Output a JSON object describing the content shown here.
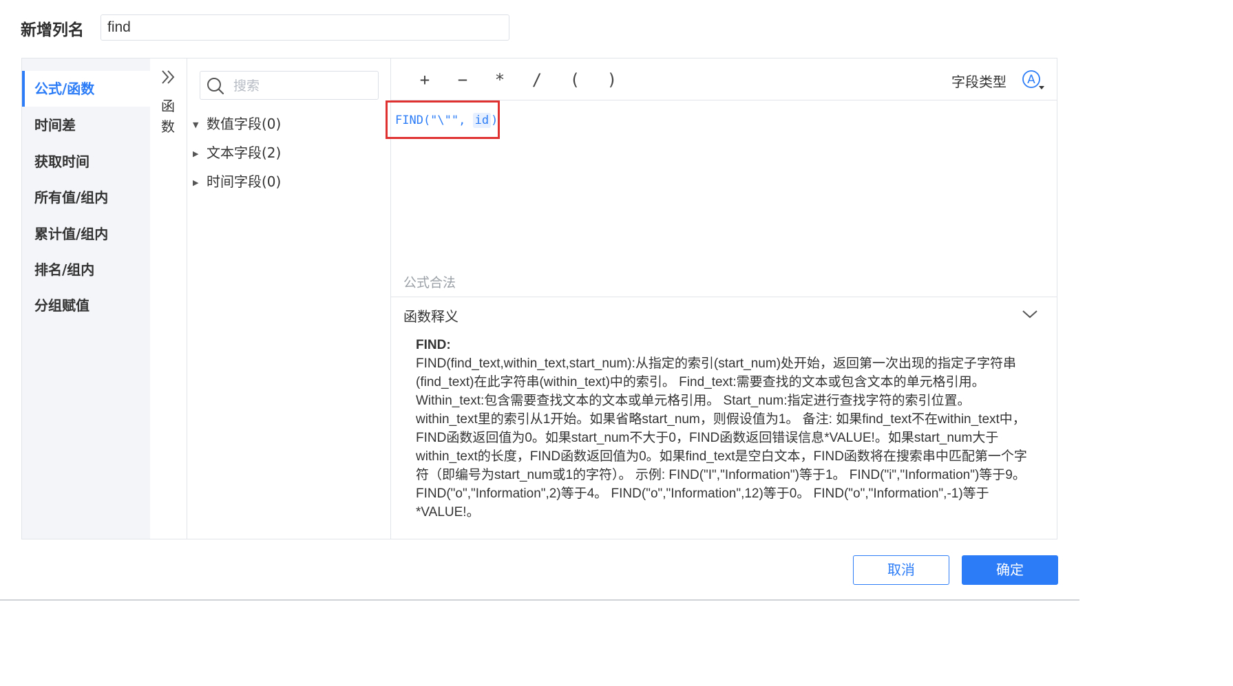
{
  "column_name": {
    "label": "新增列名",
    "value": "find"
  },
  "categories": [
    {
      "label": "公式/函数",
      "active": true
    },
    {
      "label": "时间差"
    },
    {
      "label": "获取时间"
    },
    {
      "label": "所有值/组内"
    },
    {
      "label": "累计值/组内"
    },
    {
      "label": "排名/组内"
    },
    {
      "label": "分组赋值"
    }
  ],
  "function_tab": {
    "label": "函数",
    "expand_icon": "double-chevron-right-icon"
  },
  "search": {
    "placeholder": "搜索",
    "value": ""
  },
  "field_groups": [
    {
      "label": "数值字段(0)",
      "expanded": true
    },
    {
      "label": "文本字段(2)",
      "expanded": false
    },
    {
      "label": "时间字段(0)",
      "expanded": false
    }
  ],
  "operators": [
    "+",
    "−",
    "*",
    "/",
    "(",
    ")"
  ],
  "field_type": {
    "label": "字段类型",
    "icon": "circled-a-dropdown-icon"
  },
  "formula": {
    "prefix": "FIND(\"\\\"\",",
    "field": "id",
    "suffix": ")"
  },
  "validity": "公式合法",
  "explanation": {
    "title": "函数释义",
    "heading": "FIND:",
    "body": "FIND(find_text,within_text,start_num):从指定的索引(start_num)处开始，返回第一次出现的指定子字符串(find_text)在此字符串(within_text)中的索引。 Find_text:需要查找的文本或包含文本的单元格引用。 Within_text:包含需要查找文本的文本或单元格引用。 Start_num:指定进行查找字符的索引位置。within_text里的索引从1开始。如果省略start_num，则假设值为1。 备注: 如果find_text不在within_text中，FIND函数返回值为0。如果start_num不大于0，FIND函数返回错误信息*VALUE!。如果start_num大于within_text的长度，FIND函数返回值为0。如果find_text是空白文本，FIND函数将在搜索串中匹配第一个字符（即编号为start_num或1的字符）。 示例: FIND(\"I\",\"Information\")等于1。 FIND(\"i\",\"Information\")等于9。 FIND(\"o\",\"Information\",2)等于4。 FIND(\"o\",\"Information\",12)等于0。 FIND(\"o\",\"Information\",-1)等于*VALUE!。"
  },
  "buttons": {
    "cancel": "取消",
    "ok": "确定"
  },
  "colors": {
    "accent": "#2b7cf6",
    "highlight": "#e03131",
    "sidebar_bg": "#f3f5f8"
  }
}
